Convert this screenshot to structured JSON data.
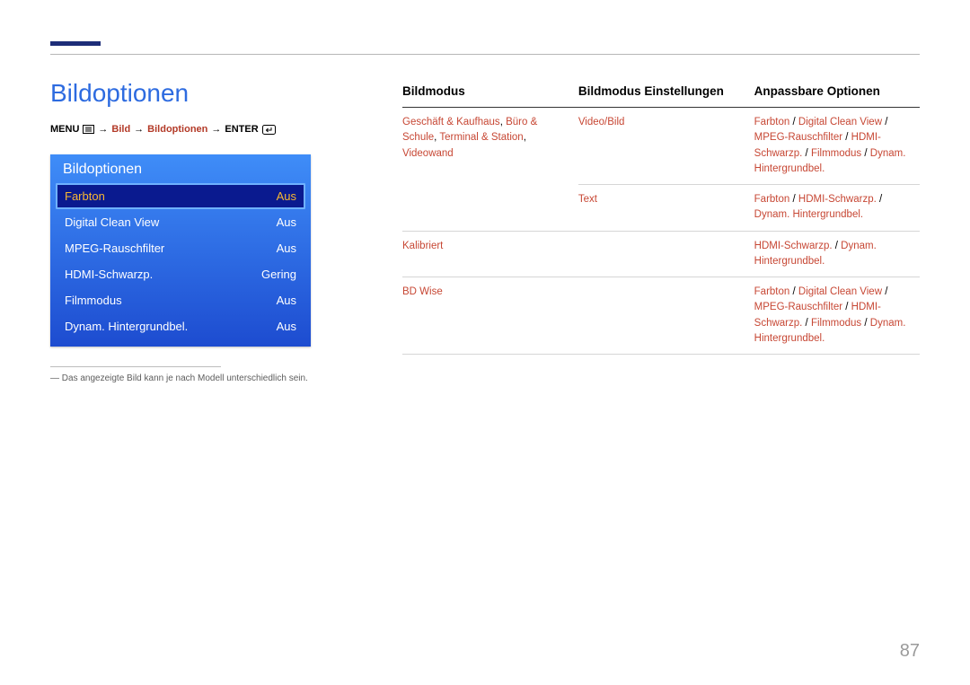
{
  "title": "Bildoptionen",
  "breadcrumb": {
    "menu": "MENU",
    "arrow": "→",
    "p1": "Bild",
    "p2": "Bildoptionen",
    "enter": "ENTER"
  },
  "osd": {
    "title": "Bildoptionen",
    "items": [
      {
        "label": "Farbton",
        "value": "Aus",
        "selected": true
      },
      {
        "label": "Digital Clean View",
        "value": "Aus",
        "selected": false
      },
      {
        "label": "MPEG-Rauschfilter",
        "value": "Aus",
        "selected": false
      },
      {
        "label": "HDMI-Schwarzp.",
        "value": "Gering",
        "selected": false
      },
      {
        "label": "Filmmodus",
        "value": "Aus",
        "selected": false
      },
      {
        "label": "Dynam. Hintergrundbel.",
        "value": "Aus",
        "selected": false
      }
    ]
  },
  "footnote": "Das angezeigte Bild kann je nach Modell unterschiedlich sein.",
  "table": {
    "headers": [
      "Bildmodus",
      "Bildmodus Einstellungen",
      "Anpassbare Optionen"
    ],
    "rows": [
      {
        "col1": [
          {
            "t": "Geschäft & Kaufhaus",
            "hl": true
          },
          {
            "t": ", ",
            "hl": false
          },
          {
            "t": "Büro & Schule",
            "hl": true
          },
          {
            "t": ", ",
            "hl": false
          },
          {
            "t": "Terminal & Station",
            "hl": true
          },
          {
            "t": ", ",
            "hl": false
          },
          {
            "t": "Videowand",
            "hl": true
          }
        ],
        "col2": [
          {
            "t": "Video/Bild",
            "hl": true
          }
        ],
        "col3": [
          {
            "t": "Farbton",
            "hl": true
          },
          {
            "t": " / ",
            "hl": false
          },
          {
            "t": "Digital Clean View",
            "hl": true
          },
          {
            "t": " / ",
            "hl": false
          },
          {
            "t": "MPEG-Rauschfilter",
            "hl": true
          },
          {
            "t": " / ",
            "hl": false
          },
          {
            "t": "HDMI-Schwarzp.",
            "hl": true
          },
          {
            "t": " / ",
            "hl": false
          },
          {
            "t": "Filmmodus",
            "hl": true
          },
          {
            "t": " / ",
            "hl": false
          },
          {
            "t": "Dynam. Hintergrundbel.",
            "hl": true
          }
        ]
      },
      {
        "col1": [],
        "col2": [
          {
            "t": "Text",
            "hl": true
          }
        ],
        "col3": [
          {
            "t": "Farbton",
            "hl": true
          },
          {
            "t": " / ",
            "hl": false
          },
          {
            "t": "HDMI-Schwarzp.",
            "hl": true
          },
          {
            "t": " / ",
            "hl": false
          },
          {
            "t": "Dynam. Hintergrundbel.",
            "hl": true
          }
        ]
      },
      {
        "col1": [
          {
            "t": "Kalibriert",
            "hl": true
          }
        ],
        "col2": [],
        "col3": [
          {
            "t": "HDMI-Schwarzp.",
            "hl": true
          },
          {
            "t": " / ",
            "hl": false
          },
          {
            "t": "Dynam. Hintergrundbel.",
            "hl": true
          }
        ]
      },
      {
        "col1": [
          {
            "t": "BD Wise",
            "hl": true
          }
        ],
        "col2": [],
        "col3": [
          {
            "t": "Farbton",
            "hl": true
          },
          {
            "t": " / ",
            "hl": false
          },
          {
            "t": "Digital Clean View",
            "hl": true
          },
          {
            "t": " / ",
            "hl": false
          },
          {
            "t": "MPEG-Rauschfilter",
            "hl": true
          },
          {
            "t": " / ",
            "hl": false
          },
          {
            "t": "HDMI-Schwarzp.",
            "hl": true
          },
          {
            "t": " / ",
            "hl": false
          },
          {
            "t": "Filmmodus",
            "hl": true
          },
          {
            "t": " / ",
            "hl": false
          },
          {
            "t": "Dynam. Hintergrundbel.",
            "hl": true
          }
        ]
      }
    ]
  },
  "page_number": "87"
}
